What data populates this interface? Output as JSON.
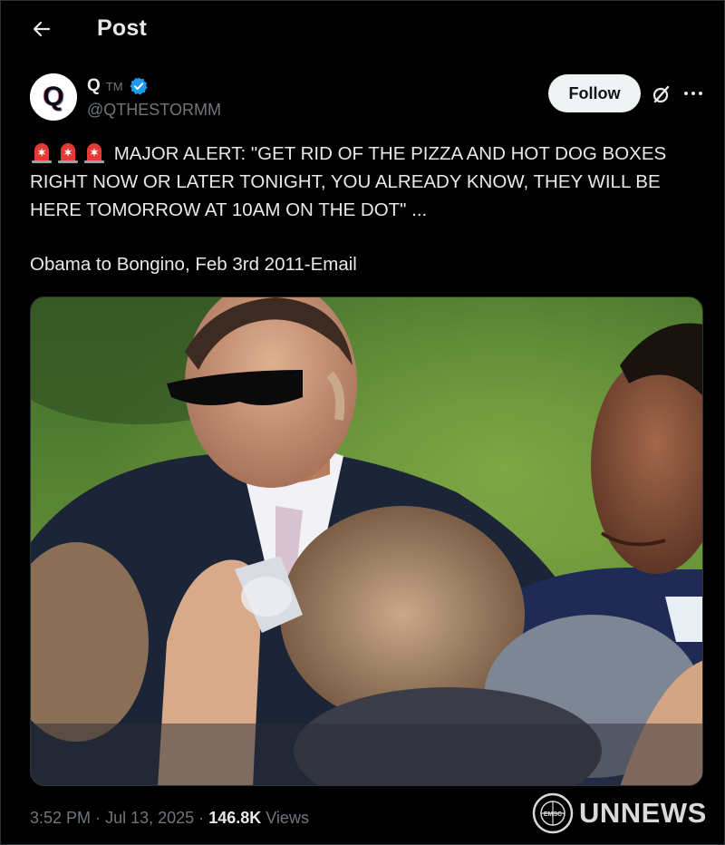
{
  "header": {
    "title": "Post",
    "back_icon": "arrow-left-icon"
  },
  "author": {
    "display_name": "Q",
    "name_suffix": "TM",
    "handle": "@QTHESTORMM",
    "avatar_letter": "Q",
    "verified_color": "#1d9bf0"
  },
  "actions": {
    "follow_label": "Follow",
    "grok_icon": "grok-icon",
    "more_icon": "more-options-icon"
  },
  "post": {
    "emoji_icon": "police-siren-icon",
    "line1": "MAJOR ALERT: \"GET RID OF THE PIZZA AND HOT DOG BOXES",
    "line2": "RIGHT NOW OR LATER TONIGHT, YOU ALREADY KNOW, THEY WILL BE",
    "line3": "HERE TOMORROW AT 10AM ON THE DOT\" ...",
    "signature": "Obama to Bongino, Feb 3rd 2011-Email"
  },
  "media": {
    "description_icon": "photo-icon"
  },
  "footer": {
    "time": "3:52 PM",
    "separator": "·",
    "date": "Jul 13, 2025",
    "views_count": "146.8K",
    "views_label": "Views"
  },
  "watermark": {
    "text": "UNNEWS",
    "emblem_text": "EMSC"
  },
  "colors": {
    "background": "#000000",
    "text_primary": "#e7e9ea",
    "text_secondary": "#71767b",
    "follow_bg": "#eff3f4",
    "verified": "#1d9bf0"
  }
}
